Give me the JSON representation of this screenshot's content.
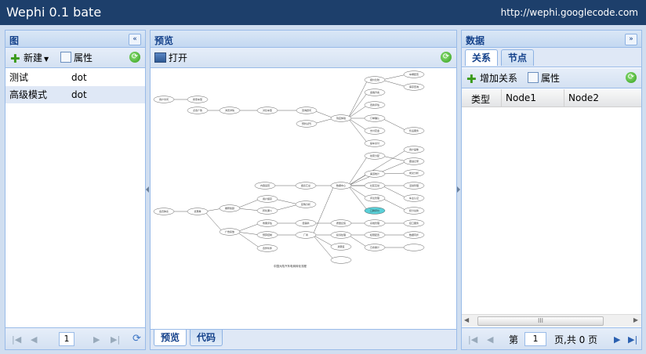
{
  "header": {
    "title": "Wephi 0.1 bate",
    "url": "http://wephi.googlecode.com"
  },
  "left": {
    "title": "图",
    "collapse_icon": "double-chevron-left-icon",
    "new_label": "新建",
    "props_label": "属性",
    "rows": [
      {
        "name": "测试",
        "type": "dot"
      },
      {
        "name": "高级模式",
        "type": "dot"
      }
    ],
    "page": "1"
  },
  "center": {
    "title": "预览",
    "open_label": "打开",
    "tabs": [
      "预览",
      "代码"
    ],
    "graph_caption": "中国大陆汽车电商转化流程"
  },
  "right": {
    "title": "数据",
    "expand_icon": "double-chevron-right-icon",
    "tabs": [
      "关系",
      "节点"
    ],
    "add_label": "增加关系",
    "props_label": "属性",
    "columns": [
      "类型",
      "Node1",
      "Node2"
    ],
    "page_prefix": "第",
    "page": "1",
    "page_suffix": "页,共 0 页",
    "scroll_grip": "III"
  },
  "graph": {
    "nodes": [
      {
        "id": "a1",
        "label": "用户访问"
      },
      {
        "id": "a2",
        "label": "搜索车型"
      },
      {
        "id": "b1",
        "label": "点击广告"
      },
      {
        "id": "b2",
        "label": "浏览详情"
      },
      {
        "id": "b3",
        "label": "对比车型"
      },
      {
        "id": "b4",
        "label": "咨询顾问"
      },
      {
        "id": "b5",
        "label": "预约试驾"
      },
      {
        "id": "b6",
        "label": "到店体验"
      },
      {
        "id": "c1",
        "label": "报价比较"
      },
      {
        "id": "c2",
        "label": "金融方案"
      },
      {
        "id": "c3",
        "label": "置换评估"
      },
      {
        "id": "c4",
        "label": "订单确认"
      },
      {
        "id": "c5",
        "label": "支付定金"
      },
      {
        "id": "c6",
        "label": "提车交付"
      },
      {
        "id": "c7",
        "label": "售后服务"
      },
      {
        "id": "c8",
        "label": "保险办理"
      },
      {
        "id": "c9",
        "label": "上牌服务"
      },
      {
        "id": "d1",
        "label": "车辆配置"
      },
      {
        "id": "d2",
        "label": "库存查询"
      },
      {
        "id": "e1",
        "label": "用户画像"
      },
      {
        "id": "e2",
        "label": "线索分配"
      },
      {
        "id": "e3",
        "label": "跟进记录"
      },
      {
        "id": "e4",
        "label": "成交分析"
      },
      {
        "id": "e5",
        "label": "渠道统计"
      },
      {
        "id": "e6",
        "label": "活动管理"
      },
      {
        "id": "f1",
        "label": "数据中心"
      },
      {
        "id": "f2",
        "label": "报表汇总"
      },
      {
        "id": "g1",
        "label": "内容运营"
      },
      {
        "id": "g2",
        "label": "社区互动"
      },
      {
        "id": "g3",
        "label": "评论管理"
      },
      {
        "id": "g4",
        "label": "口碑评价"
      },
      {
        "id": "g5",
        "label": "车主认证"
      },
      {
        "id": "g6",
        "label": "积分兑换"
      },
      {
        "id": "h1",
        "label": "会员体系"
      },
      {
        "id": "h2",
        "label": "优惠券"
      },
      {
        "id": "h3",
        "label": "推荐奖励"
      },
      {
        "id": "h4",
        "label": "用户留存"
      },
      {
        "id": "h5",
        "label": "转化漏斗"
      },
      {
        "id": "h6",
        "label": "复购分析"
      },
      {
        "id": "i1",
        "label": "广告投放"
      },
      {
        "id": "i2",
        "label": "效果评估"
      },
      {
        "id": "i3",
        "label": "预算控制"
      },
      {
        "id": "j1",
        "label": "合作伙伴"
      },
      {
        "id": "j2",
        "label": "经销商"
      },
      {
        "id": "j3",
        "label": "厂商"
      },
      {
        "id": "k1",
        "label": "质量反馈"
      },
      {
        "id": "k2",
        "label": "投诉处理"
      },
      {
        "id": "k3",
        "label": "满意度"
      },
      {
        "id": "l1",
        "label": "系统管理"
      },
      {
        "id": "l2",
        "label": "权限配置"
      },
      {
        "id": "l3",
        "label": "日志审计"
      },
      {
        "id": "m1",
        "label": "接口服务"
      },
      {
        "id": "m2",
        "label": "数据同步"
      }
    ]
  }
}
